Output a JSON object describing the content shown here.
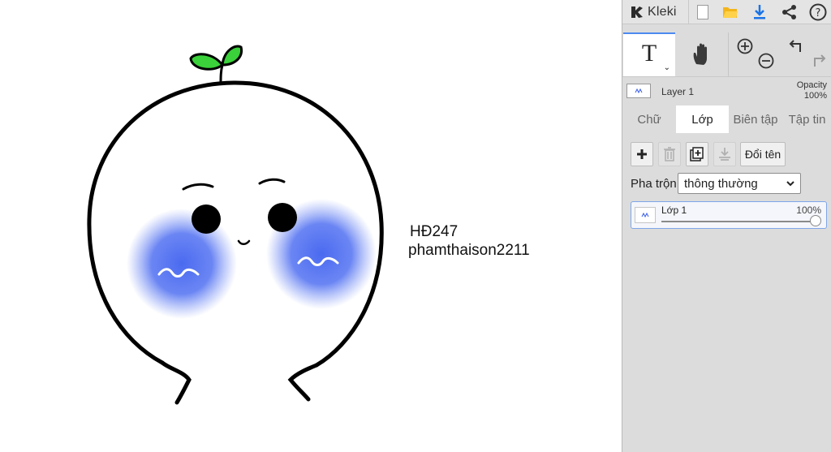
{
  "canvas": {
    "text_lines": [
      "HĐ247",
      "phamthaison2211"
    ]
  },
  "topbar": {
    "app_name": "Kleki",
    "icons": [
      "kleki-logo-icon",
      "new-image-icon",
      "open-folder-icon",
      "download-icon",
      "share-icon",
      "help-icon"
    ],
    "accent_color": "#1a73e8"
  },
  "tools": {
    "items": [
      "text-tool-icon",
      "hand-tool-icon",
      "zoom-in-icon",
      "zoom-out-icon",
      "undo-icon",
      "redo-icon"
    ],
    "active": "text"
  },
  "layer_summary": {
    "name": "Layer 1",
    "opacity_label": "Opacity",
    "opacity_value": "100%"
  },
  "tabs": [
    {
      "label": "Chữ",
      "active": false
    },
    {
      "label": "Lớp",
      "active": true
    },
    {
      "label": "Biên tập",
      "active": false
    },
    {
      "label": "Tập tin",
      "active": false
    }
  ],
  "layers": {
    "rename_label": "Đổi tên",
    "blend_label": "Pha trộn",
    "blend_value": "thông thường",
    "items": [
      {
        "name": "Lớp 1",
        "opacity": "100%",
        "opacity_value": 1.0
      }
    ]
  }
}
